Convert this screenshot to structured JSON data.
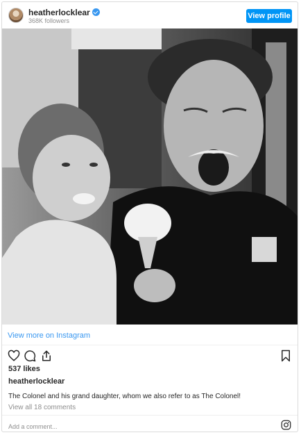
{
  "header": {
    "username": "heatherlocklear",
    "followers": "368K followers",
    "view_profile_label": "View profile",
    "verified": true
  },
  "post": {
    "photo_icon": "photo",
    "view_more_label": "View more on Instagram",
    "likes": "537 likes",
    "owner": "heatherlocklear",
    "caption": "The Colonel and his grand daughter, whom we also refer to as The Colonel!",
    "comments_link": "View all 18 comments",
    "comment_placeholder": "Add a comment..."
  },
  "icons": {
    "like": "heart-icon",
    "comment": "comment-icon",
    "share": "share-icon",
    "save": "bookmark-icon",
    "instagram": "instagram-icon"
  },
  "colors": {
    "accent": "#0095f6",
    "link": "#3897f0",
    "muted": "#8e8e8e",
    "border": "#dbdbdb"
  }
}
